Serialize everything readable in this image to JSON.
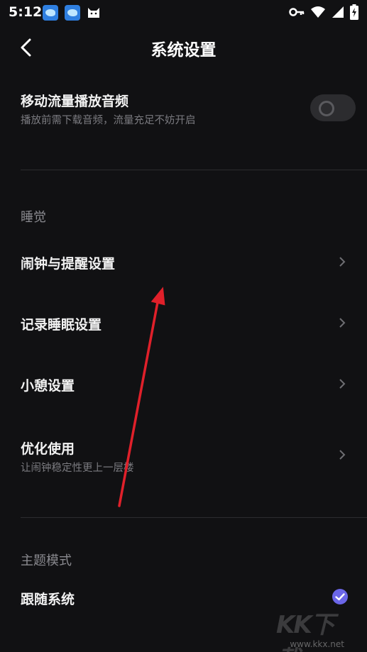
{
  "status_bar": {
    "time": "5:12",
    "icons": [
      "app-icon",
      "app-icon",
      "cat-icon",
      "key-icon",
      "wifi-icon",
      "signal-icon",
      "battery-charging-icon"
    ]
  },
  "header": {
    "title": "系统设置",
    "back_icon": "chevron-left-icon"
  },
  "mobile_data": {
    "title": "移动流量播放音频",
    "subtitle": "播放前需下载音频，流量充足不妨开启",
    "toggle_on": false
  },
  "sleep_section": {
    "label": "睡觉",
    "items": [
      {
        "title": "闹钟与提醒设置",
        "subtitle": ""
      },
      {
        "title": "记录睡眠设置",
        "subtitle": ""
      },
      {
        "title": "小憩设置",
        "subtitle": ""
      },
      {
        "title": "优化使用",
        "subtitle": "让闹钟稳定性更上一层楼"
      }
    ]
  },
  "theme_section": {
    "label": "主题模式",
    "items": [
      {
        "title": "跟随系统",
        "selected": true
      }
    ]
  },
  "colors": {
    "background": "#111113",
    "accent": "#6b66e8",
    "annotation_arrow": "#e0202a"
  },
  "watermark": {
    "logo": "KK下载",
    "url": "www.kkx.net"
  }
}
